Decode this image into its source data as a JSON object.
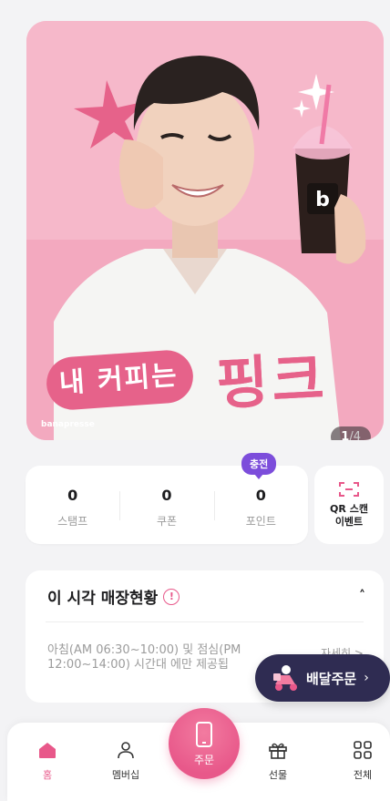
{
  "banner": {
    "headline_part1": "내 커피는",
    "headline_part2": "핑크",
    "brand": "banapresse",
    "cup_brand": "banapresse",
    "counter_current": "1",
    "counter_total": "/4"
  },
  "stats": {
    "charge_badge": "충전",
    "items": [
      {
        "value": "0",
        "label": "스탬프"
      },
      {
        "value": "0",
        "label": "쿠폰"
      },
      {
        "value": "0",
        "label": "포인트"
      }
    ]
  },
  "qr": {
    "line1": "QR 스캔",
    "line2": "이벤트"
  },
  "store_status": {
    "title": "이 시각 매장현황",
    "warning_mark": "!",
    "chevron": "˄",
    "message": "아침(AM 06:30~10:00) 및 점심(PM 12:00~14:00) 시간대 에만 제공됩",
    "more_label": "자세히 >"
  },
  "delivery": {
    "label": "배달주문",
    "chevron": "›"
  },
  "nav": {
    "home": "홈",
    "membership": "멤버십",
    "order": "주문",
    "gift": "선물",
    "all": "전체"
  },
  "colors": {
    "accent": "#e8588a",
    "charge_badge": "#7c4ddb",
    "delivery_bg": "#2f2c52",
    "banner_bg": "#f4aec3"
  },
  "icons": [
    "star-burst-icon",
    "sparkle-icon",
    "coffee-cup-icon",
    "qr-scan-icon",
    "warning-circle-icon",
    "chevron-up-icon",
    "delivery-rider-icon",
    "home-icon",
    "person-icon",
    "phone-order-icon",
    "gift-icon",
    "grid-icon"
  ]
}
